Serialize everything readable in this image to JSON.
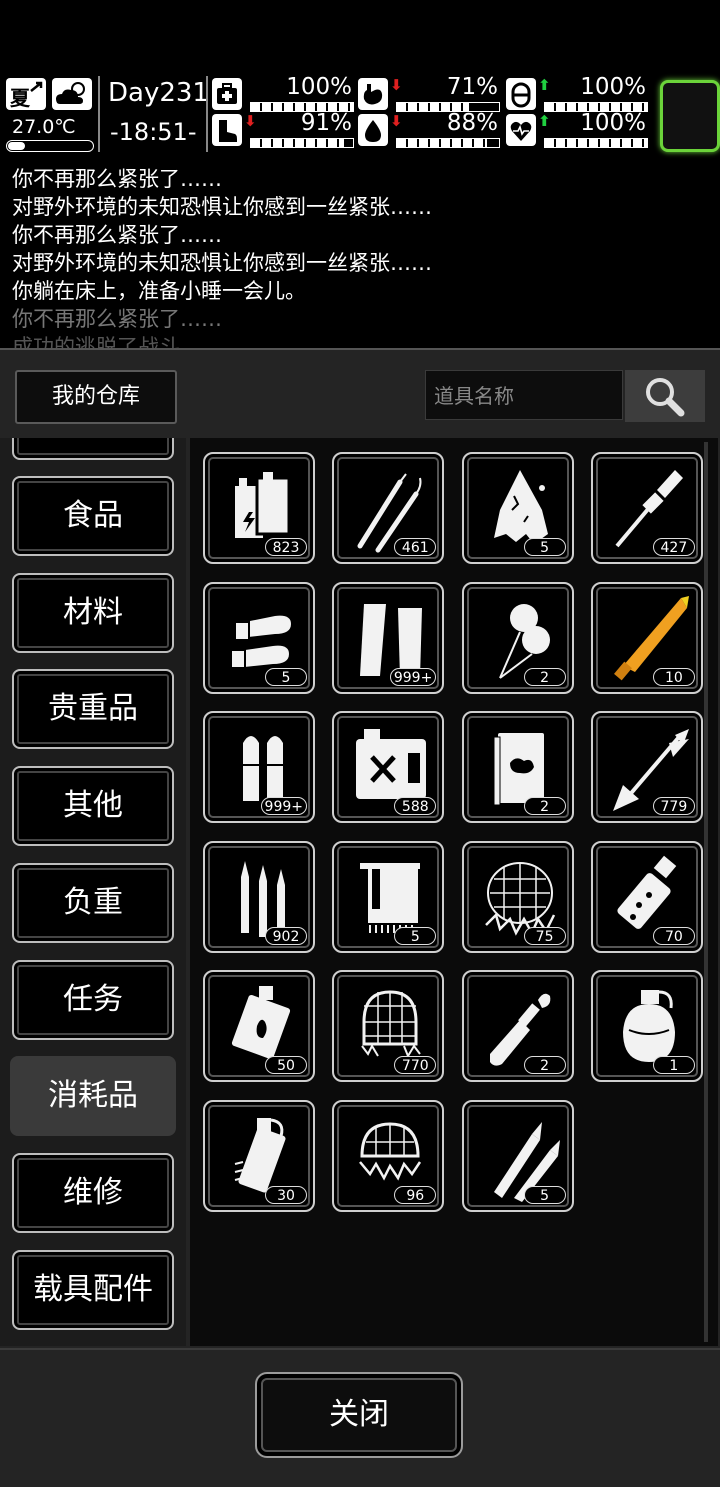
{
  "status": {
    "season": "夏",
    "weather_icon": "partly-cloudy-icon",
    "temperature": "27.0℃",
    "temperature_level": 0.2,
    "day": "Day231",
    "time": "-18:51-",
    "stats": [
      {
        "icon": "medkit-icon",
        "arrow": "",
        "percent": "100%",
        "level": 1.0
      },
      {
        "icon": "stomach-icon",
        "arrow": "down",
        "percent": "71%",
        "level": 0.71
      },
      {
        "icon": "pill-icon",
        "arrow": "up",
        "percent": "100%",
        "level": 1.0
      },
      {
        "icon": "boot-icon",
        "arrow": "down",
        "percent": "91%",
        "level": 0.91
      },
      {
        "icon": "water-drop-icon",
        "arrow": "down",
        "percent": "88%",
        "level": 0.88
      },
      {
        "icon": "heart-icon",
        "arrow": "up",
        "percent": "100%",
        "level": 1.0
      }
    ],
    "arrow_colors": {
      "down": "#e02020",
      "up": "#20d040"
    },
    "equip_slot_color": "#6bd33a"
  },
  "log": [
    "你不再那么紧张了……",
    "对野外环境的未知恐惧让你感到一丝紧张……",
    "你不再那么紧张了……",
    "对野外环境的未知恐惧让你感到一丝紧张……",
    "你躺在床上，准备小睡一会儿。",
    "你不再那么紧张了……",
    "成功的逃脱了战斗"
  ],
  "warehouse": {
    "title": "我的仓库",
    "search_placeholder": "道具名称",
    "close_label": "关闭"
  },
  "categories": [
    {
      "label": "食品",
      "active": false
    },
    {
      "label": "材料",
      "active": false
    },
    {
      "label": "贵重品",
      "active": false
    },
    {
      "label": "其他",
      "active": false
    },
    {
      "label": "负重",
      "active": false
    },
    {
      "label": "任务",
      "active": false
    },
    {
      "label": "消耗品",
      "active": true
    },
    {
      "label": "维修",
      "active": false
    },
    {
      "label": "载具配件",
      "active": false
    }
  ],
  "items": [
    {
      "icon": "battery-icon",
      "count": "823"
    },
    {
      "icon": "lockpick-icon",
      "count": "461"
    },
    {
      "icon": "torn-cloth-icon",
      "count": "5"
    },
    {
      "icon": "rocket-round-icon",
      "count": "427"
    },
    {
      "icon": "shotgun-shell-icon",
      "count": "5"
    },
    {
      "icon": "magazine-icon",
      "count": "999+"
    },
    {
      "icon": "balloon-icon",
      "count": "2"
    },
    {
      "icon": "glowing-rocket-icon",
      "count": "10"
    },
    {
      "icon": "pistol-ammo-icon",
      "count": "999+"
    },
    {
      "icon": "fuel-can-icon",
      "count": "588"
    },
    {
      "icon": "book-icon",
      "count": "2"
    },
    {
      "icon": "arrow-bolt-icon",
      "count": "779"
    },
    {
      "icon": "rifle-ammo-icon",
      "count": "902"
    },
    {
      "icon": "towel-icon",
      "count": "5"
    },
    {
      "icon": "spiked-net-icon",
      "count": "75"
    },
    {
      "icon": "flashbang-grenade-icon",
      "count": "70"
    },
    {
      "icon": "incendiary-grenade-icon",
      "count": "50"
    },
    {
      "icon": "net-trap-icon",
      "count": "770"
    },
    {
      "icon": "molotov-icon",
      "count": "2"
    },
    {
      "icon": "frag-grenade-icon",
      "count": "1"
    },
    {
      "icon": "smoke-grenade-icon",
      "count": "30"
    },
    {
      "icon": "thorn-net-icon",
      "count": "96"
    },
    {
      "icon": "sniper-round-icon",
      "count": "5"
    }
  ]
}
